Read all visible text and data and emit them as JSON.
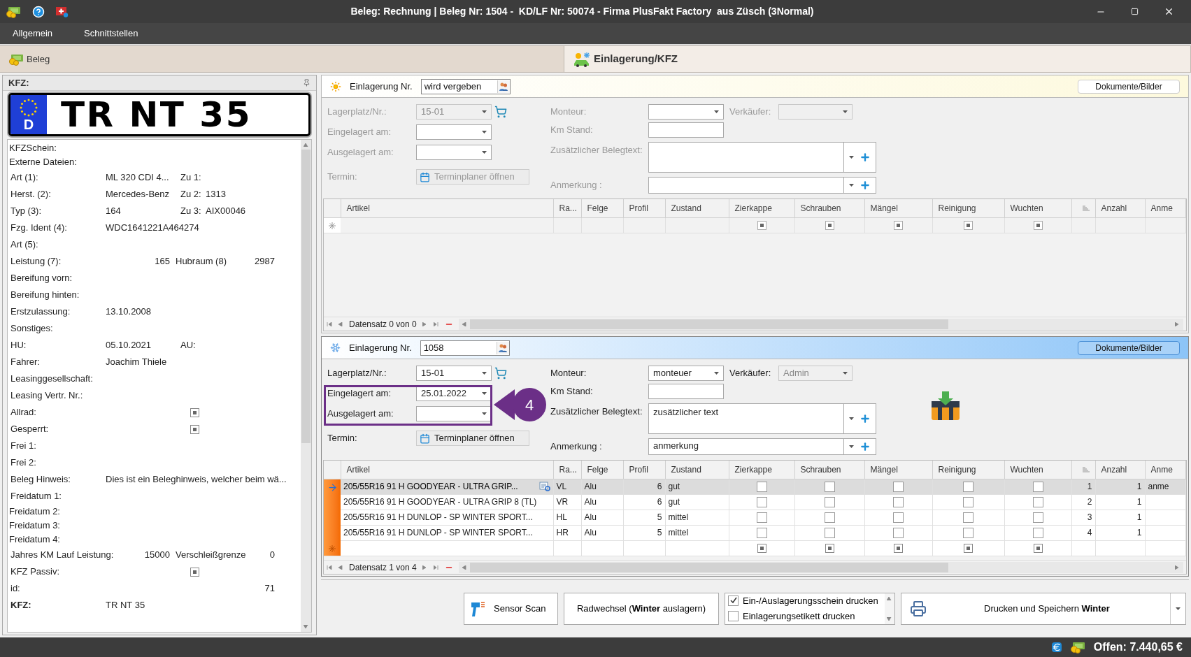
{
  "window": {
    "title": "Beleg: Rechnung | Beleg Nr: 1504 -  KD/LF Nr: 50074 - Firma PlusFakt Factory  aus Züsch (3Normal)"
  },
  "menu": [
    "Allgemein",
    "Schnittstellen"
  ],
  "tabs": [
    {
      "label": "Beleg",
      "selected": false
    },
    {
      "label": "Einlagerung/KFZ",
      "selected": true
    }
  ],
  "kfz_panel": {
    "title": "KFZ:",
    "plate": {
      "country": "D",
      "number": "TR NT 35"
    },
    "rows": [
      {
        "kind": "text",
        "label": "KFZSchein:"
      },
      {
        "kind": "text",
        "label": "Externe Dateien:"
      },
      {
        "kind": "text",
        "label": "Art (1):",
        "value": "ML 320 CDI 4...",
        "extra_label": "Zu 1:"
      },
      {
        "kind": "text",
        "label": "Herst. (2):",
        "value": "Mercedes-Benz",
        "extra_label": "Zu 2:",
        "extra_value": "1313"
      },
      {
        "kind": "text",
        "label": "Typ (3):",
        "value": "164",
        "extra_label": "Zu 3:",
        "extra_value": "AIX00046"
      },
      {
        "kind": "text",
        "label": "Fzg. Ident (4):",
        "value": "WDC1641221A464274"
      },
      {
        "kind": "text",
        "label": "Art (5):"
      },
      {
        "kind": "numbers",
        "label": "Leistung (7):",
        "value": "165",
        "extra_label": "Hubraum (8)",
        "extra_value": "2987"
      },
      {
        "kind": "text",
        "label": "Bereifung vorn:"
      },
      {
        "kind": "text",
        "label": "Bereifung hinten:"
      },
      {
        "kind": "text",
        "label": "Erstzulassung:",
        "value": "13.10.2008"
      },
      {
        "kind": "text",
        "label": "Sonstiges:"
      },
      {
        "kind": "text",
        "label": "HU:",
        "value": "05.10.2021",
        "extra_label": "AU:"
      },
      {
        "kind": "text",
        "label": "Fahrer:",
        "value": "Joachim Thiele"
      },
      {
        "kind": "text",
        "label": "Leasinggesellschaft:"
      },
      {
        "kind": "text",
        "label": "Leasing Vertr. Nr.:"
      },
      {
        "kind": "check",
        "label": "Allrad:",
        "indeterminate": true
      },
      {
        "kind": "check",
        "label": "Gesperrt:",
        "indeterminate": true
      },
      {
        "kind": "text",
        "label": "Frei 1:"
      },
      {
        "kind": "text",
        "label": "Frei 2:"
      },
      {
        "kind": "text",
        "label": "Beleg Hinweis:",
        "value": "Dies ist ein Beleghinweis, welcher beim wä..."
      },
      {
        "kind": "text",
        "label": "Freidatum 1:"
      },
      {
        "kind": "compact",
        "label": "Freidatum 2:"
      },
      {
        "kind": "compact",
        "label": "Freidatum 3:"
      },
      {
        "kind": "compact",
        "label": "Freidatum 4:"
      },
      {
        "kind": "numbers",
        "label": "Jahres KM Lauf Leistung:",
        "value": "15000",
        "extra_label": "Verschleißgrenze",
        "extra_value": "0"
      },
      {
        "kind": "check",
        "label": "KFZ Passiv:",
        "indeterminate": true
      },
      {
        "kind": "numbers",
        "label": "id:",
        "extra_value": "71"
      },
      {
        "kind": "text",
        "label": "KFZ:",
        "value": "TR NT 35",
        "bold": true
      }
    ]
  },
  "sections": [
    {
      "kind": "summer",
      "enabled": false,
      "number_label": "Einlagerung Nr.",
      "number": "wird vergeben",
      "documents_button": "Dokumente/Bilder",
      "lagerplatz": {
        "label": "Lagerplatz/Nr.:",
        "value": "15-01"
      },
      "eingelagert": {
        "label": "Eingelagert am:"
      },
      "ausgelagert": {
        "label": "Ausgelagert am:"
      },
      "termin": {
        "label": "Termin:",
        "button": "Terminplaner öffnen"
      },
      "monteur": {
        "label": "Monteur:"
      },
      "verkaeufer": {
        "label": "Verkäufer:"
      },
      "km": {
        "label": "Km Stand:"
      },
      "belegtext": {
        "label": "Zusätzlicher Belegtext:"
      },
      "anmerkung": {
        "label": "Anmerkung :"
      },
      "columns": [
        {
          "kind": "text",
          "label": "Artikel"
        },
        {
          "kind": "text",
          "label": "Ra..."
        },
        {
          "kind": "text",
          "label": "Felge"
        },
        {
          "kind": "number",
          "label": "Profil"
        },
        {
          "kind": "text",
          "label": "Zustand"
        },
        {
          "kind": "check",
          "label": "Zierkappe"
        },
        {
          "kind": "check",
          "label": "Schrauben"
        },
        {
          "kind": "check",
          "label": "Mängel"
        },
        {
          "kind": "check",
          "label": "Reinigung"
        },
        {
          "kind": "check",
          "label": "Wuchten"
        },
        {
          "kind": "sort"
        },
        {
          "kind": "number",
          "label": "Anzahl"
        },
        {
          "kind": "text",
          "label": "Anme"
        }
      ],
      "new_row": {
        "indeterminate": true
      },
      "navigator": "Datensatz 0 von 0"
    },
    {
      "kind": "winter",
      "enabled": true,
      "number_label": "Einlagerung Nr.",
      "number": "1058",
      "documents_button": "Dokumente/Bilder",
      "lagerplatz": {
        "label": "Lagerplatz/Nr.:",
        "value": "15-01"
      },
      "eingelagert": {
        "label": "Eingelagert am:",
        "value": "25.01.2022"
      },
      "ausgelagert": {
        "label": "Ausgelagert am:"
      },
      "termin": {
        "label": "Termin:",
        "button": "Terminplaner öffnen"
      },
      "monteur": {
        "label": "Monteur:",
        "value": "monteuer"
      },
      "verkaeufer": {
        "label": "Verkäufer:",
        "value": "Admin"
      },
      "km": {
        "label": "Km Stand:"
      },
      "belegtext": {
        "label": "Zusätzlicher Belegtext:",
        "value": "zusätzlicher text"
      },
      "anmerkung": {
        "label": "Anmerkung :",
        "value": "anmerkung"
      },
      "annotation": {
        "label": "4"
      },
      "columns": [
        {
          "kind": "text",
          "label": "Artikel"
        },
        {
          "kind": "text",
          "label": "Ra..."
        },
        {
          "kind": "text",
          "label": "Felge"
        },
        {
          "kind": "number",
          "label": "Profil"
        },
        {
          "kind": "text",
          "label": "Zustand"
        },
        {
          "kind": "check",
          "label": "Zierkappe"
        },
        {
          "kind": "check",
          "label": "Schrauben"
        },
        {
          "kind": "check",
          "label": "Mängel"
        },
        {
          "kind": "check",
          "label": "Reinigung"
        },
        {
          "kind": "check",
          "label": "Wuchten"
        },
        {
          "kind": "sort"
        },
        {
          "kind": "number",
          "label": "Anzahl"
        },
        {
          "kind": "text",
          "label": "Anme"
        }
      ],
      "rows": [
        {
          "selected": true,
          "cells": [
            "205/55R16 91 H GOODYEAR - ULTRA GRIP...",
            "VL",
            "Alu",
            "6",
            "gut",
            false,
            false,
            false,
            false,
            false,
            "1",
            "1",
            "anme"
          ]
        },
        {
          "selected": false,
          "cells": [
            "205/55R16 91 H GOODYEAR - ULTRA GRIP 8 (TL)",
            "VR",
            "Alu",
            "6",
            "gut",
            false,
            false,
            false,
            false,
            false,
            "2",
            "1",
            null
          ]
        },
        {
          "selected": false,
          "cells": [
            "205/55R16 91 H DUNLOP - SP WINTER SPORT...",
            "HL",
            "Alu",
            "5",
            "mittel",
            false,
            false,
            false,
            false,
            false,
            "3",
            "1",
            null
          ]
        },
        {
          "selected": false,
          "cells": [
            "205/55R16 91 H DUNLOP - SP WINTER SPORT...",
            "HR",
            "Alu",
            "5",
            "mittel",
            false,
            false,
            false,
            false,
            false,
            "4",
            "1",
            null
          ]
        }
      ],
      "new_row": {
        "indeterminate": true
      },
      "navigator": "Datensatz 1 von 4"
    }
  ],
  "actions": {
    "sensor_button": "Sensor Scan",
    "swap_button": "Radwechsel (**Winter** auslagern)",
    "print_options": [
      {
        "label": "Ein-/Auslagerungsschein drucken",
        "checked": true
      },
      {
        "label": "Einlagerungsetikett drucken",
        "checked": false
      }
    ],
    "save_button": "Drucken und Speichern **Winter**"
  },
  "status_bar": {
    "open_amount": "Offen: 7.440,65 €"
  }
}
